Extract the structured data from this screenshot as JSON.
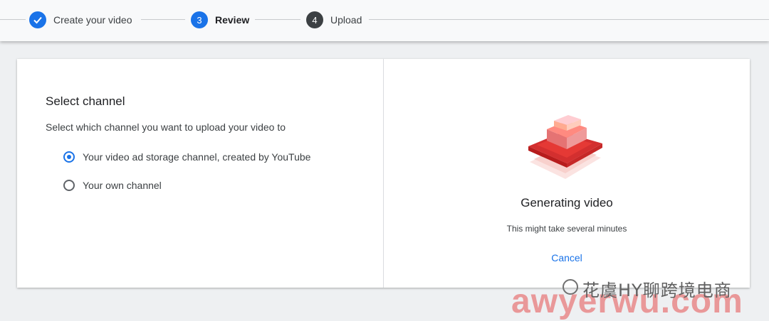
{
  "stepper": {
    "steps": [
      {
        "number": "✓",
        "label": "Create your video",
        "state": "done"
      },
      {
        "number": "3",
        "label": "Review",
        "state": "active"
      },
      {
        "number": "4",
        "label": "Upload",
        "state": "pending"
      }
    ]
  },
  "channel_select": {
    "title": "Select channel",
    "description": "Select which channel you want to upload your video to",
    "options": [
      {
        "label": "Your video ad storage channel, created by YouTube",
        "selected": true
      },
      {
        "label": "Your own channel",
        "selected": false
      }
    ]
  },
  "status": {
    "title": "Generating video",
    "subtitle": "This might take several minutes",
    "cancel_label": "Cancel"
  },
  "watermark": {
    "chinese": "花虞HY聊跨境电商",
    "latin": "awyerwu.com"
  },
  "colors": {
    "accent": "#1a73e8",
    "pending_step": "#3c4043",
    "illustration_red": "#e53935"
  }
}
